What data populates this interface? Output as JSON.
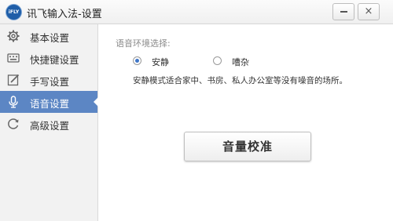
{
  "window": {
    "logo_text": "iFLY",
    "title": "讯飞输入法-设置",
    "close_glyph": "×"
  },
  "sidebar": {
    "items": [
      {
        "label": "基本设置",
        "icon": "gear-icon"
      },
      {
        "label": "快捷键设置",
        "icon": "keyboard-icon"
      },
      {
        "label": "手写设置",
        "icon": "handwriting-icon"
      },
      {
        "label": "语音设置",
        "icon": "microphone-icon",
        "active": true
      },
      {
        "label": "高级设置",
        "icon": "refresh-icon"
      }
    ],
    "active_color": "#5c86c4"
  },
  "main": {
    "section_label": "语音环境选择:",
    "options": [
      {
        "label": "安静",
        "checked": true
      },
      {
        "label": "嘈杂",
        "checked": false
      }
    ],
    "description": "安静模式适合家中、书房、私人办公室等没有噪音的场所。",
    "calibrate_button": "音量校准"
  }
}
